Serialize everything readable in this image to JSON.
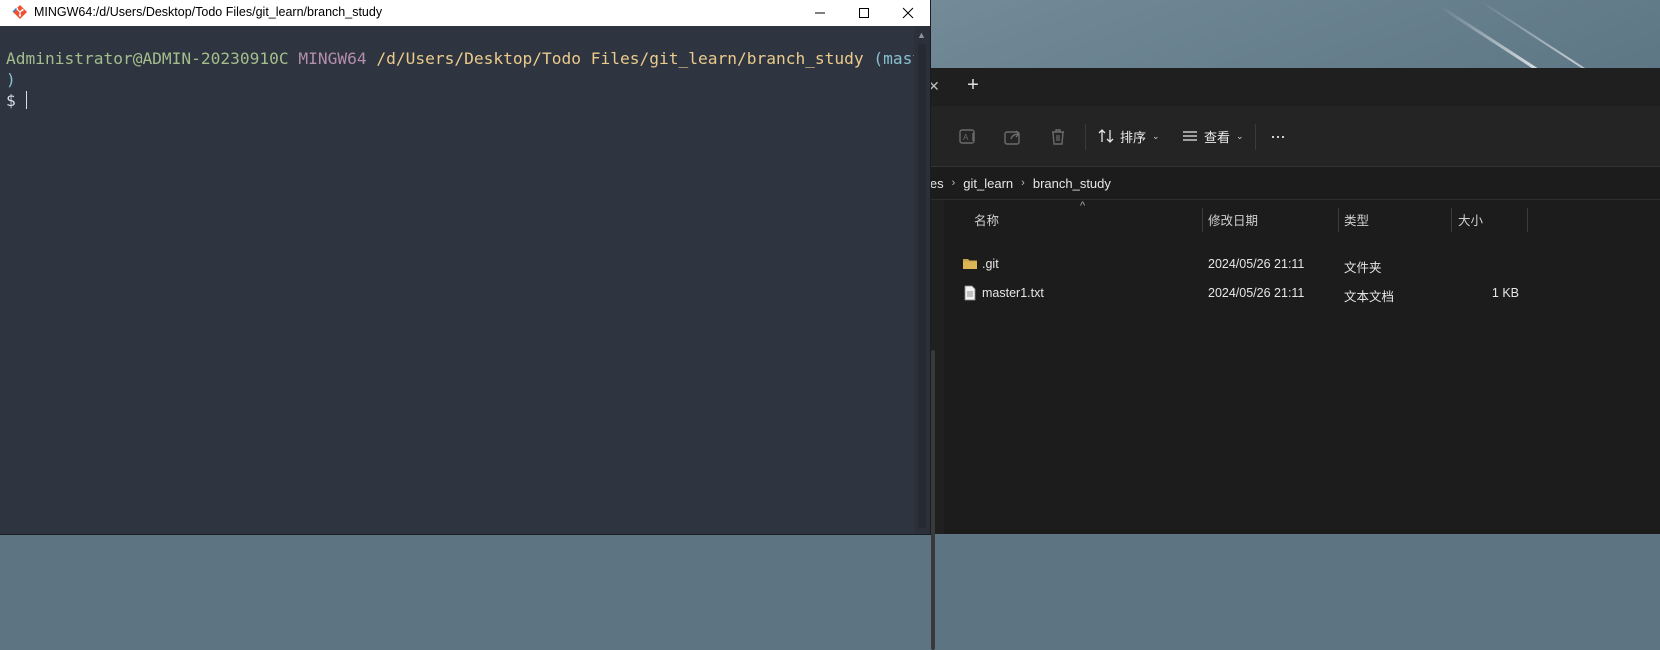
{
  "terminal_window": {
    "title": "MINGW64:/d/Users/Desktop/Todo Files/git_learn/branch_study",
    "controls": {
      "minimize": "—",
      "maximize": "☐",
      "close": "✕"
    },
    "prompt": {
      "user_host": "Administrator@ADMIN-20230910C",
      "system": "MINGW64",
      "path": "/d/Users/Desktop/Todo Files/git_learn/branch_study",
      "branch_open": "(master",
      "branch_close": ")",
      "symbol": "$"
    }
  },
  "explorer_window": {
    "tab_close_glyph": "✕",
    "new_tab_glyph": "+",
    "toolbar": {
      "sort_label": "排序",
      "view_label": "查看",
      "more_label": "···"
    },
    "breadcrumb": {
      "partial": "les",
      "items": [
        "git_learn",
        "branch_study"
      ],
      "separator": "›"
    },
    "columns": {
      "name": "名称",
      "modified": "修改日期",
      "type": "类型",
      "size": "大小",
      "sort_indicator": "^"
    },
    "files": [
      {
        "name": ".git",
        "modified": "2024/05/26 21:11",
        "type": "文件夹",
        "size": "",
        "icon": "folder-icon"
      },
      {
        "name": "master1.txt",
        "modified": "2024/05/26 21:11",
        "type": "文本文档",
        "size": "1 KB",
        "icon": "text-file-icon"
      }
    ]
  }
}
